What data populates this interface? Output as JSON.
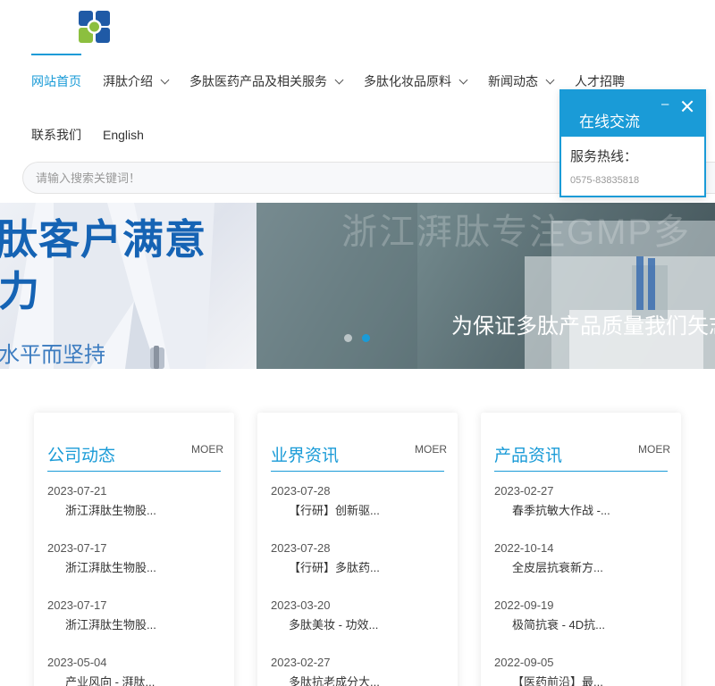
{
  "nav": {
    "items": [
      {
        "label": "网站首页",
        "active": true,
        "dropdown": false
      },
      {
        "label": "湃肽介绍",
        "active": false,
        "dropdown": true
      },
      {
        "label": "多肽医药产品及相关服务",
        "active": false,
        "dropdown": true
      },
      {
        "label": "多肽化妆品原料",
        "active": false,
        "dropdown": true
      },
      {
        "label": "新闻动态",
        "active": false,
        "dropdown": true
      },
      {
        "label": "人才招聘",
        "active": false,
        "dropdown": false
      },
      {
        "label": "联系我们",
        "active": false,
        "dropdown": false
      },
      {
        "label": "English",
        "active": false,
        "dropdown": false
      }
    ]
  },
  "search": {
    "placeholder": "请输入搜索关键词！",
    "value": ""
  },
  "banner": {
    "left_headline_1": "肽客户满意",
    "left_headline_2": "力",
    "left_subline": "水平而坚持",
    "right_watermark": "浙江湃肽专注GMP多",
    "right_caption": "为保证多肽产品质量我们矢志",
    "slide_count": 2,
    "active_slide": 2
  },
  "chat": {
    "title": "在线交流",
    "minimize": "–",
    "label": "服务热线：",
    "phone": "0575-83835818"
  },
  "cards": [
    {
      "title": "公司动态",
      "more": "MOER",
      "items": [
        {
          "date": "2023-07-21",
          "title": "浙江湃肽生物股..."
        },
        {
          "date": "2023-07-17",
          "title": "浙江湃肽生物股..."
        },
        {
          "date": "2023-07-17",
          "title": "浙江湃肽生物股..."
        },
        {
          "date": "2023-05-04",
          "title": "产业风向 - 湃肽..."
        }
      ]
    },
    {
      "title": "业界资讯",
      "more": "MOER",
      "items": [
        {
          "date": "2023-07-28",
          "title": "【行研】创新驱..."
        },
        {
          "date": "2023-07-28",
          "title": "【行研】多肽药..."
        },
        {
          "date": "2023-03-20",
          "title": "多肽美妆 - 功效..."
        },
        {
          "date": "2023-02-27",
          "title": "多肽抗老成分大..."
        }
      ]
    },
    {
      "title": "产品资讯",
      "more": "MOER",
      "items": [
        {
          "date": "2023-02-27",
          "title": "春季抗敏大作战 -..."
        },
        {
          "date": "2022-10-14",
          "title": "全皮层抗衰新方..."
        },
        {
          "date": "2022-09-19",
          "title": "极简抗衰 - 4D抗..."
        },
        {
          "date": "2022-09-05",
          "title": "【医药前沿】最..."
        }
      ]
    }
  ],
  "colors": {
    "accent": "#1a9bd7",
    "banner_text": "#1563b4",
    "logo_blue": "#1f5aa6",
    "logo_green": "#8cbf3f"
  }
}
